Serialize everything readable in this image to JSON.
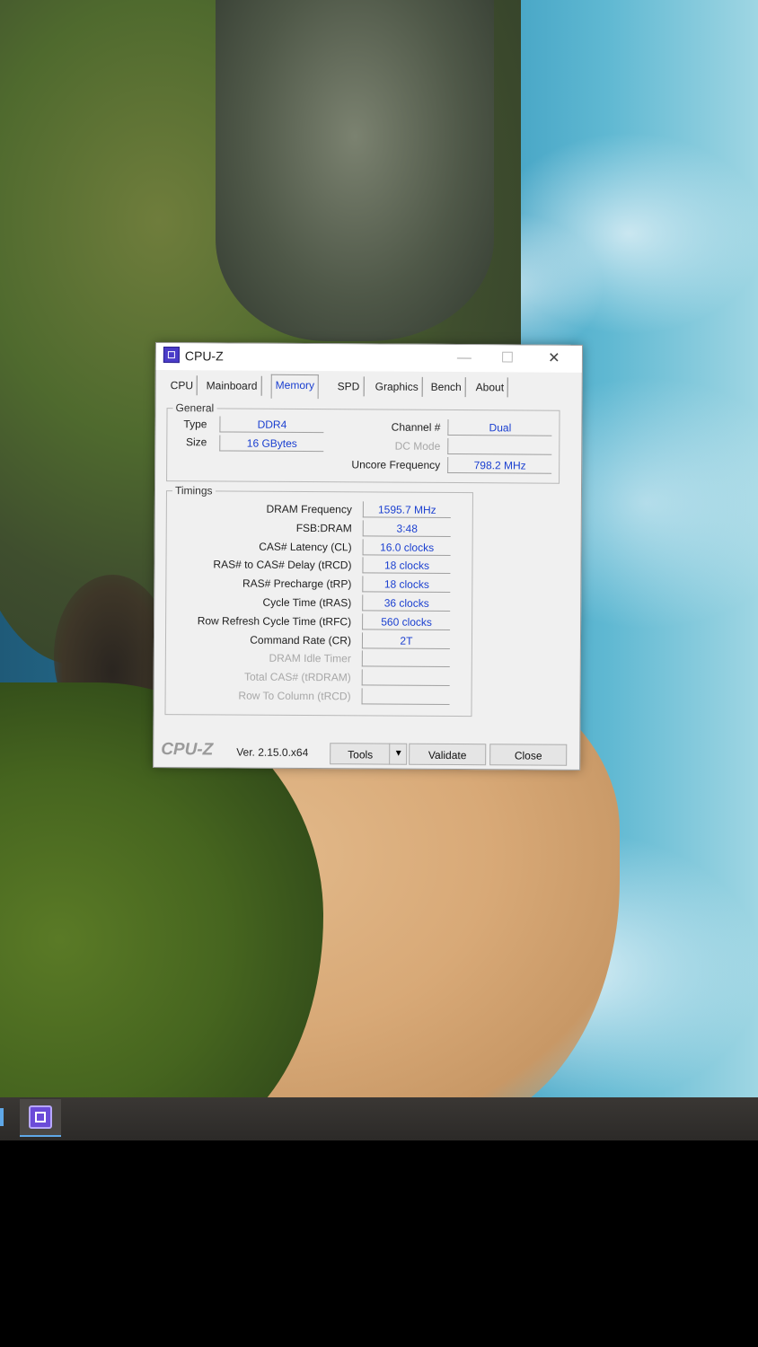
{
  "window": {
    "title": "CPU-Z",
    "minimize": "—",
    "maximize": "☐",
    "close": "✕"
  },
  "tabs": [
    "CPU",
    "Mainboard",
    "Memory",
    "SPD",
    "Graphics",
    "Bench",
    "About"
  ],
  "active_tab": "Memory",
  "general": {
    "label": "General",
    "type_label": "Type",
    "type_value": "DDR4",
    "size_label": "Size",
    "size_value": "16 GBytes",
    "channel_label": "Channel #",
    "channel_value": "Dual",
    "dc_mode_label": "DC Mode",
    "dc_mode_value": "",
    "uncore_label": "Uncore Frequency",
    "uncore_value": "798.2 MHz"
  },
  "timings": {
    "label": "Timings",
    "rows": [
      {
        "label": "DRAM Frequency",
        "value": "1595.7 MHz",
        "enabled": true
      },
      {
        "label": "FSB:DRAM",
        "value": "3:48",
        "enabled": true
      },
      {
        "label": "CAS# Latency (CL)",
        "value": "16.0 clocks",
        "enabled": true
      },
      {
        "label": "RAS# to CAS# Delay (tRCD)",
        "value": "18 clocks",
        "enabled": true
      },
      {
        "label": "RAS# Precharge (tRP)",
        "value": "18 clocks",
        "enabled": true
      },
      {
        "label": "Cycle Time (tRAS)",
        "value": "36 clocks",
        "enabled": true
      },
      {
        "label": "Row Refresh Cycle Time (tRFC)",
        "value": "560 clocks",
        "enabled": true
      },
      {
        "label": "Command Rate (CR)",
        "value": "2T",
        "enabled": true
      },
      {
        "label": "DRAM Idle Timer",
        "value": "",
        "enabled": false
      },
      {
        "label": "Total CAS# (tRDRAM)",
        "value": "",
        "enabled": false
      },
      {
        "label": "Row To Column (tRCD)",
        "value": "",
        "enabled": false
      }
    ]
  },
  "footer": {
    "brand": "CPU-Z",
    "version": "Ver. 2.15.0.x64",
    "tools_label": "Tools",
    "tools_arrow": "▼",
    "validate_label": "Validate",
    "close_label": "Close"
  },
  "colors": {
    "value_text": "#1a3fd0",
    "window_bg": "#f0f0f0"
  }
}
